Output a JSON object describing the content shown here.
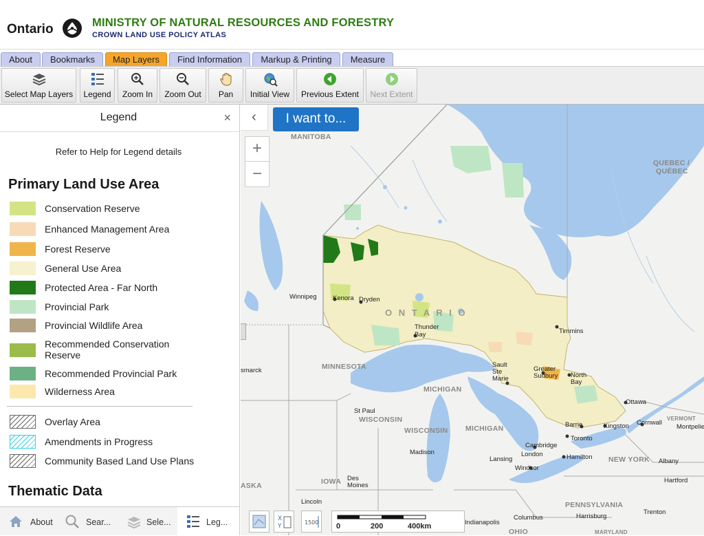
{
  "header": {
    "logo_text": "Ontario",
    "ministry": "MINISTRY OF NATURAL RESOURCES AND FORESTRY",
    "atlas": "CROWN LAND USE POLICY ATLAS"
  },
  "tabs": [
    {
      "label": "About",
      "active": false
    },
    {
      "label": "Bookmarks",
      "active": false
    },
    {
      "label": "Map Layers",
      "active": true
    },
    {
      "label": "Find Information",
      "active": false
    },
    {
      "label": "Markup & Printing",
      "active": false
    },
    {
      "label": "Measure",
      "active": false
    }
  ],
  "toolbar": {
    "select_layers": "Select Map Layers",
    "legend": "Legend",
    "zoom_in": "Zoom In",
    "zoom_out": "Zoom Out",
    "pan": "Pan",
    "initial_view": "Initial View",
    "previous_extent": "Previous Extent",
    "next_extent": "Next Extent"
  },
  "panel": {
    "title": "Legend",
    "close": "×",
    "help": "Refer to Help for Legend details",
    "primary_heading": "Primary Land Use Area",
    "primary_items": [
      {
        "label": "Conservation Reserve",
        "color": "#d3e484"
      },
      {
        "label": "Enhanced Management Area",
        "color": "#f6dbb6"
      },
      {
        "label": "Forest Reserve",
        "color": "#f0b54a"
      },
      {
        "label": "General Use Area",
        "color": "#f6f2cf"
      },
      {
        "label": "Protected Area - Far North",
        "color": "#217a17"
      },
      {
        "label": "Provincial Park",
        "color": "#bfe6c4"
      },
      {
        "label": "Provincial Wildlife Area",
        "color": "#b3a183"
      },
      {
        "label": "Recommended Conservation",
        "label2": "Reserve",
        "color": "#9bbb4a"
      },
      {
        "label": "Recommended Provincial Park",
        "color": "#6cb184"
      },
      {
        "label": "Wilderness Area",
        "color": "#fde7ad"
      }
    ],
    "overlay_items": [
      {
        "label": "Overlay Area",
        "color": "#666666"
      },
      {
        "label": "Amendments in Progress",
        "color": "#33d0e6"
      },
      {
        "label": "Community Based Land Use Plans",
        "color": "#666666"
      }
    ],
    "thematic_heading": "Thematic Data"
  },
  "bottom_tabs": [
    {
      "label": "About",
      "icon": "home-icon"
    },
    {
      "label": "Sear...",
      "icon": "search-icon"
    },
    {
      "label": "Sele...",
      "icon": "layers-icon"
    },
    {
      "label": "Leg...",
      "icon": "legend-icon"
    }
  ],
  "map": {
    "collapse": "‹",
    "i_want_to": "I want to...",
    "zoom_in": "+",
    "zoom_out": "−",
    "scale_labels": [
      "0",
      "200",
      "400km"
    ],
    "scale_text": "1500",
    "labels": {
      "manitoba": "MANITOBA",
      "quebec": "QUEBEC /",
      "quebec2": "QUÉBEC",
      "ontario": "O N T A R I O",
      "minnesota": "MINNESOTA",
      "michigan1": "MICHIGAN",
      "michigan2": "MICHIGAN",
      "wisconsin1": "WISCONSIN",
      "wisconsin2": "WISCONSIN",
      "iowa": "IOWA",
      "new_york": "NEW YORK",
      "pennsylvania": "PENNSYLVANIA",
      "ohio": "OHIO",
      "vermont": "VERMONT",
      "winnipeg": "Winnipeg",
      "kenora": "Kenora",
      "dryden": "Dryden",
      "thunder_bay": "Thunder",
      "thunder_bay2": "Bay",
      "timmins": "Timmins",
      "sault": "Sault",
      "sault2": "Ste",
      "sault3": "Marie",
      "sudbury": "Greater",
      "sudbury2": "Sudbury",
      "north_bay": "North",
      "north_bay2": "Bay",
      "ottawa": "Ottawa",
      "cornwall": "Cornwall",
      "barrie": "Barrie",
      "kingston": "Kingston",
      "toronto": "Toronto",
      "hamilton": "Hamilton",
      "cambridge": "Cambridge",
      "london": "London",
      "windsor": "Windsor",
      "lansing": "Lansing",
      "madison": "Madison",
      "st_paul": "St Paul",
      "des_moines": "Des",
      "des_moines2": "Moines",
      "lincoln": "Lincoln",
      "columbus": "Columbus",
      "harrisburg": "Harrisburg",
      "trenton": "Trenton",
      "hartford": "Hartford",
      "albany": "Albany",
      "montpelier": "Montpelie",
      "bismarck": "smarck",
      "indianapolis": "Indianapolis",
      "aska": "ASKA",
      "maryland": "MARYLAND"
    }
  }
}
